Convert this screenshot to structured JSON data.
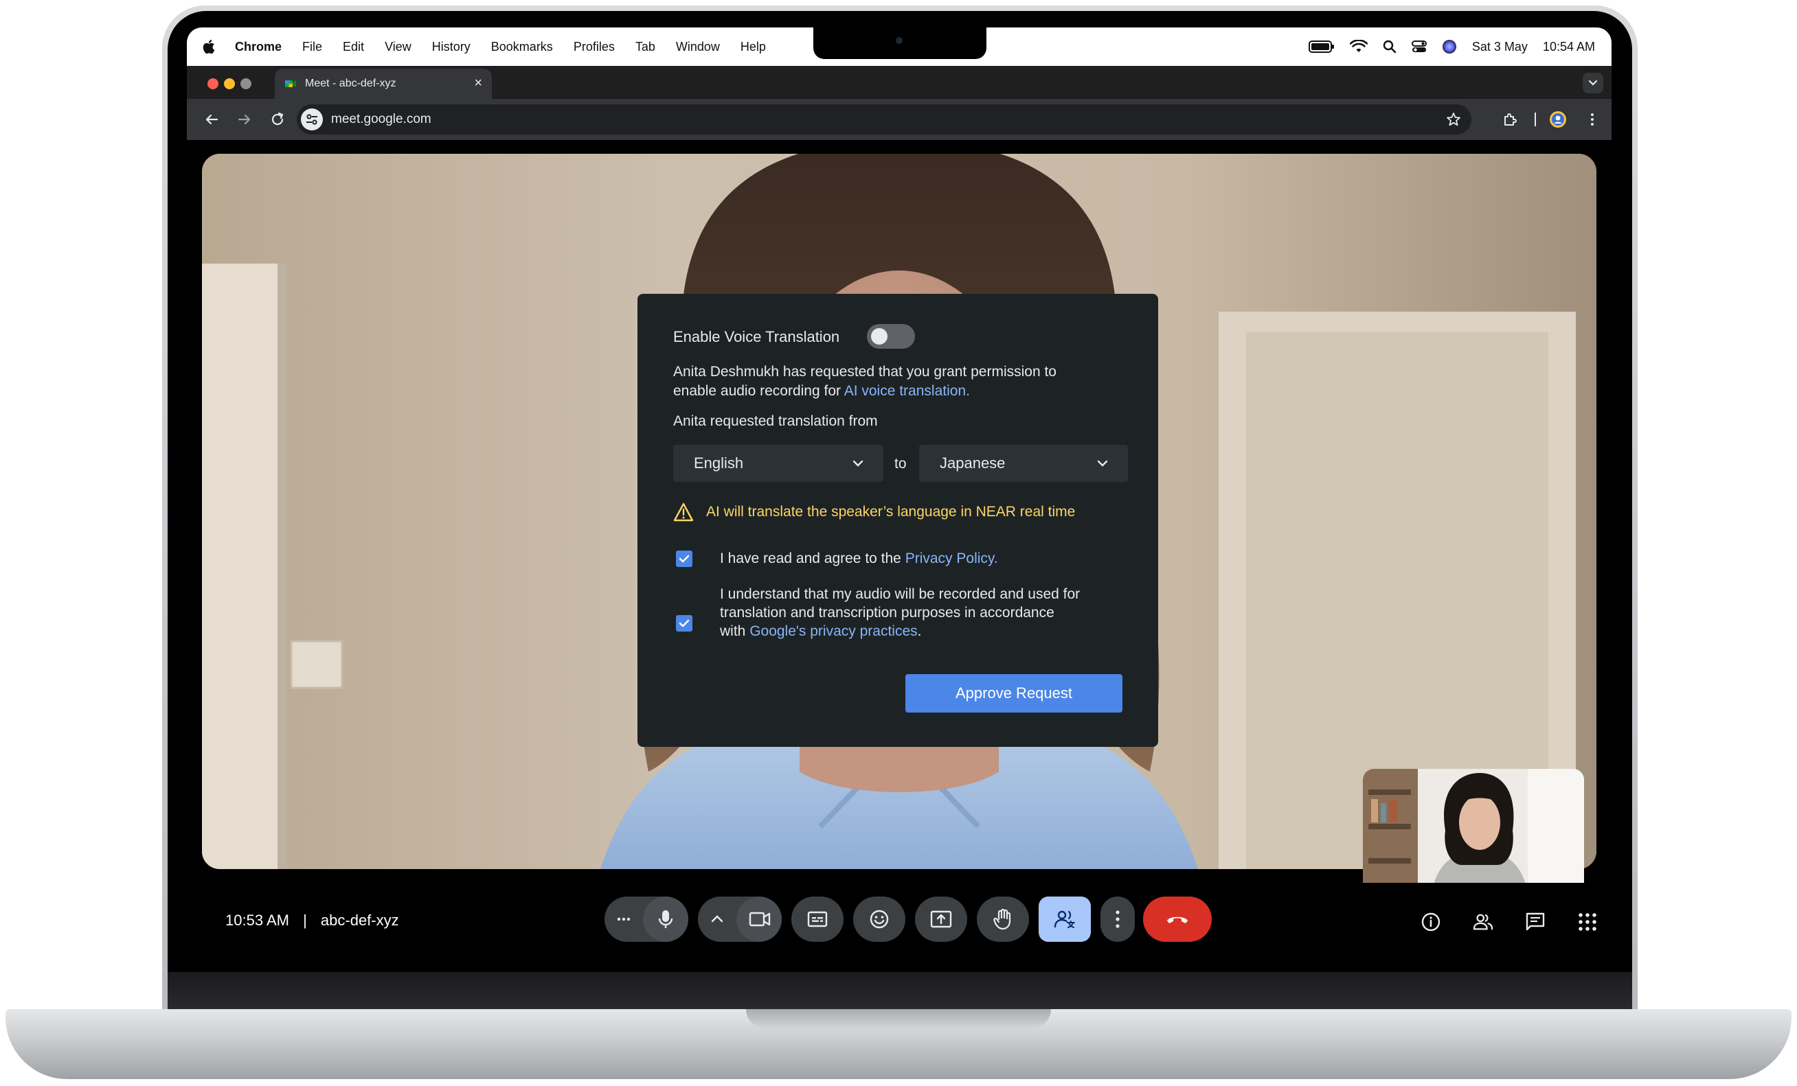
{
  "menubar": {
    "app": "Chrome",
    "items": [
      "File",
      "Edit",
      "View",
      "History",
      "Bookmarks",
      "Profiles",
      "Tab",
      "Window",
      "Help"
    ],
    "date": "Sat 3 May",
    "time": "10:54 AM"
  },
  "browser": {
    "tab_title": "Meet - abc-def-xyz",
    "url": "meet.google.com"
  },
  "dialog": {
    "toggle_label": "Enable Voice Translation",
    "toggle_on": false,
    "request_text_1": "Anita Deshmukh has requested that you grant permission to",
    "request_text_2": "enable audio recording for ",
    "request_link": "AI voice translation.",
    "from_label": "Anita requested translation from",
    "source_language": "English",
    "to_label": "to",
    "target_language": "Japanese",
    "warning": "AI will translate the speaker’s language in NEAR real time",
    "consent_1_text": "I have read and agree to the ",
    "consent_1_link": "Privacy Policy.",
    "consent_1_checked": true,
    "consent_2_line_1": "I understand that my audio will be recorded and used for",
    "consent_2_line_2": "translation and transcription purposes in accordance",
    "consent_2_line_3": "with ",
    "consent_2_link": "Google's privacy practices",
    "consent_2_end": ".",
    "consent_2_checked": true,
    "approve_label": "Approve Request"
  },
  "meeting": {
    "time": "10:53 AM",
    "separator": "|",
    "code": "abc-def-xyz"
  },
  "colors": {
    "accent": "#4b86e8",
    "link": "#8ab4f8",
    "warning": "#fdd663",
    "end_call": "#d93025",
    "active_control": "#a8c7fa"
  }
}
